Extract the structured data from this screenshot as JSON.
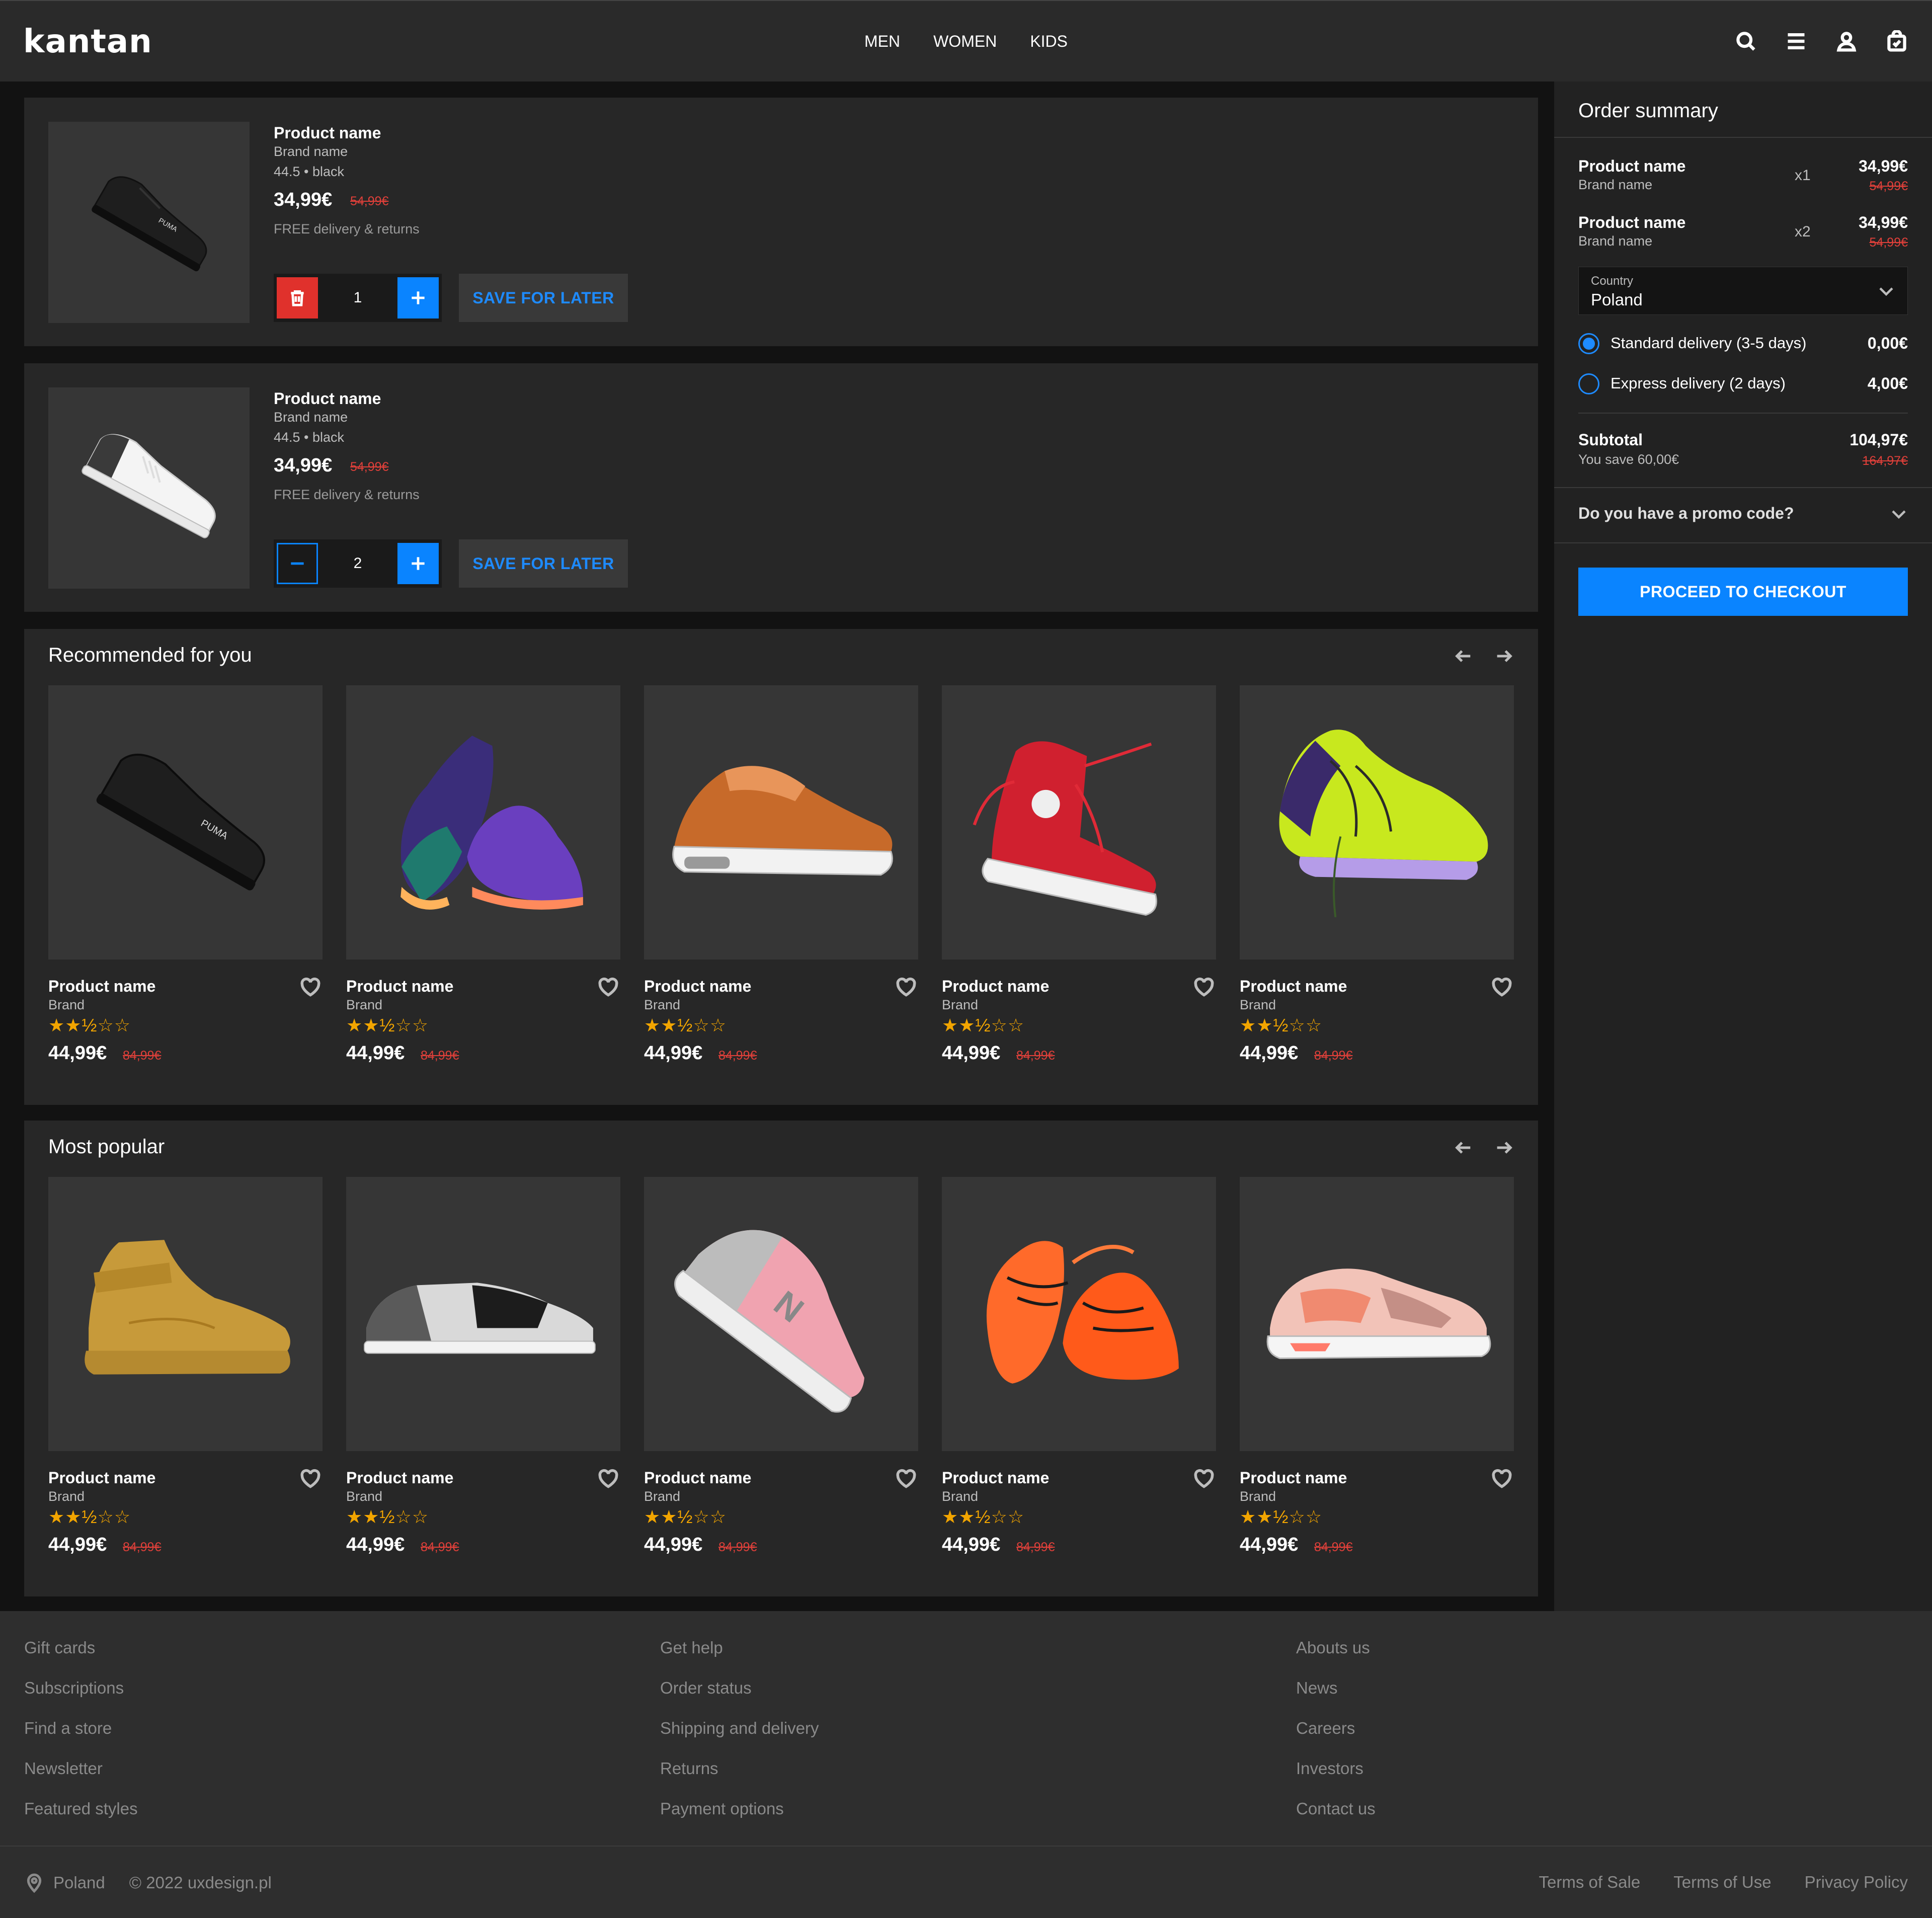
{
  "header": {
    "logo": "kantan",
    "nav": [
      "MEN",
      "WOMEN",
      "KIDS"
    ]
  },
  "cart": {
    "items": [
      {
        "name": "Product name",
        "brand": "Brand name",
        "variant": "44.5 • black",
        "price": "34,99€",
        "old_price": "54,99€",
        "delivery": "FREE delivery & returns",
        "quantity": "1",
        "save_label": "SAVE FOR LATER"
      },
      {
        "name": "Product name",
        "brand": "Brand name",
        "variant": "44.5 • black",
        "price": "34,99€",
        "old_price": "54,99€",
        "delivery": "FREE delivery & returns",
        "quantity": "2",
        "save_label": "SAVE FOR LATER"
      }
    ]
  },
  "recommended": {
    "title": "Recommended for you",
    "products": [
      {
        "name": "Product name",
        "brand": "Brand",
        "price": "44,99€",
        "old_price": "84,99€",
        "rating": 2.5,
        "stars": "★★½☆☆"
      },
      {
        "name": "Product name",
        "brand": "Brand",
        "price": "44,99€",
        "old_price": "84,99€",
        "rating": 2.5,
        "stars": "★★½☆☆"
      },
      {
        "name": "Product name",
        "brand": "Brand",
        "price": "44,99€",
        "old_price": "84,99€",
        "rating": 2.5,
        "stars": "★★½☆☆"
      },
      {
        "name": "Product name",
        "brand": "Brand",
        "price": "44,99€",
        "old_price": "84,99€",
        "rating": 2.5,
        "stars": "★★½☆☆"
      },
      {
        "name": "Product name",
        "brand": "Brand",
        "price": "44,99€",
        "old_price": "84,99€",
        "rating": 2.5,
        "stars": "★★½☆☆"
      }
    ]
  },
  "popular": {
    "title": "Most popular",
    "products": [
      {
        "name": "Product name",
        "brand": "Brand",
        "price": "44,99€",
        "old_price": "84,99€",
        "rating": 2.5,
        "stars": "★★½☆☆"
      },
      {
        "name": "Product name",
        "brand": "Brand",
        "price": "44,99€",
        "old_price": "84,99€",
        "rating": 2.5,
        "stars": "★★½☆☆"
      },
      {
        "name": "Product name",
        "brand": "Brand",
        "price": "44,99€",
        "old_price": "84,99€",
        "rating": 2.5,
        "stars": "★★½☆☆"
      },
      {
        "name": "Product name",
        "brand": "Brand",
        "price": "44,99€",
        "old_price": "84,99€",
        "rating": 2.5,
        "stars": "★★½☆☆"
      },
      {
        "name": "Product name",
        "brand": "Brand",
        "price": "44,99€",
        "old_price": "84,99€",
        "rating": 2.5,
        "stars": "★★½☆☆"
      }
    ]
  },
  "summary": {
    "title": "Order summary",
    "lines": [
      {
        "name": "Product name",
        "brand": "Brand name",
        "qty": "x1",
        "price": "34,99€",
        "old_price": "54,99€"
      },
      {
        "name": "Product name",
        "brand": "Brand name",
        "qty": "x2",
        "price": "34,99€",
        "old_price": "54,99€"
      }
    ],
    "country_label": "Country",
    "country_value": "Poland",
    "delivery": [
      {
        "label": "Standard delivery (3-5 days)",
        "price": "0,00€",
        "selected": true
      },
      {
        "label": "Express delivery (2 days)",
        "price": "4,00€",
        "selected": false
      }
    ],
    "subtotal_label": "Subtotal",
    "subtotal": "104,97€",
    "you_save": "You save 60,00€",
    "subtotal_old": "164,97€",
    "promo_label": "Do you have a promo code?",
    "checkout_label": "PROCEED TO CHECKOUT"
  },
  "footer": {
    "col1": [
      "Gift cards",
      "Subscriptions",
      "Find a store",
      "Newsletter",
      "Featured styles"
    ],
    "col2": [
      "Get help",
      "Order status",
      "Shipping and delivery",
      "Returns",
      "Payment options"
    ],
    "col3": [
      "Abouts us",
      "News",
      "Careers",
      "Investors",
      "Contact us"
    ],
    "location": "Poland",
    "copyright": "© 2022 uxdesign.pl",
    "legal": [
      "Terms of Sale",
      "Terms of Use",
      "Privacy Policy"
    ]
  },
  "colors": {
    "accent": "#0a84ff",
    "sale": "#e0403a",
    "star": "#f2a500",
    "delete": "#e0312c"
  }
}
